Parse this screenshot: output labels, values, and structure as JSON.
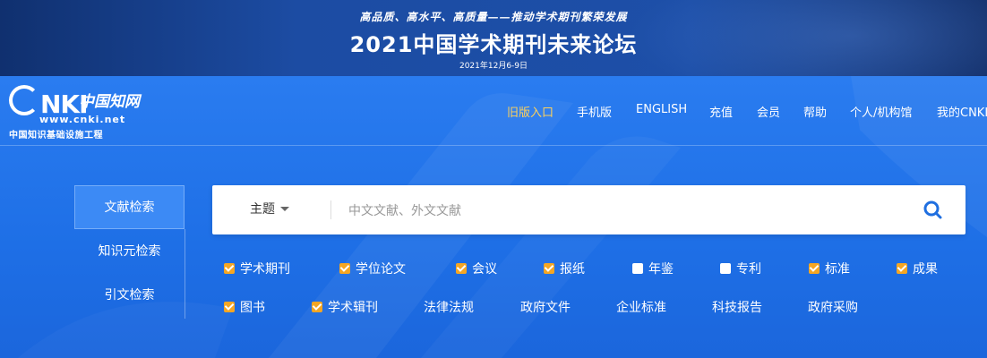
{
  "banner": {
    "slogan": "高品质、高水平、高质量——推动学术期刊繁荣发展",
    "title": "2021中国学术期刊未来论坛",
    "date": "2021年12月6-9日"
  },
  "logo": {
    "brand": "NKI",
    "cn_name": "中国知网",
    "url": "www.cnki.net",
    "subtitle": "中国知识基础设施工程"
  },
  "nav": {
    "items": [
      {
        "label": "旧版入口",
        "active": true
      },
      {
        "label": "手机版",
        "active": false
      },
      {
        "label": "ENGLISH",
        "active": false
      },
      {
        "label": "充值",
        "active": false
      },
      {
        "label": "会员",
        "active": false
      },
      {
        "label": "帮助",
        "active": false
      },
      {
        "label": "个人/机构馆",
        "active": false
      },
      {
        "label": "我的CNKI",
        "active": false
      }
    ]
  },
  "tabs": [
    {
      "label": "文献检索",
      "active": true
    },
    {
      "label": "知识元检索",
      "active": false
    },
    {
      "label": "引文检索",
      "active": false
    }
  ],
  "search": {
    "field": "主题",
    "placeholder": "中文文献、外文文献",
    "value": ""
  },
  "databases": {
    "row1": [
      {
        "label": "学术期刊",
        "checked": true
      },
      {
        "label": "学位论文",
        "checked": true
      },
      {
        "label": "会议",
        "checked": true
      },
      {
        "label": "报纸",
        "checked": true
      },
      {
        "label": "年鉴",
        "checked": false
      },
      {
        "label": "专利",
        "checked": false
      },
      {
        "label": "标准",
        "checked": true
      },
      {
        "label": "成果",
        "checked": true
      }
    ],
    "row2": [
      {
        "label": "图书",
        "checked": true
      },
      {
        "label": "学术辑刊",
        "checked": true
      }
    ],
    "links": [
      "法律法规",
      "政府文件",
      "企业标准",
      "科技报告",
      "政府采购"
    ]
  },
  "colors": {
    "accent": "#ffd25a",
    "checkbox": "#f5a623",
    "background": "#1f6fe0",
    "search_icon": "#1f6fe0"
  }
}
